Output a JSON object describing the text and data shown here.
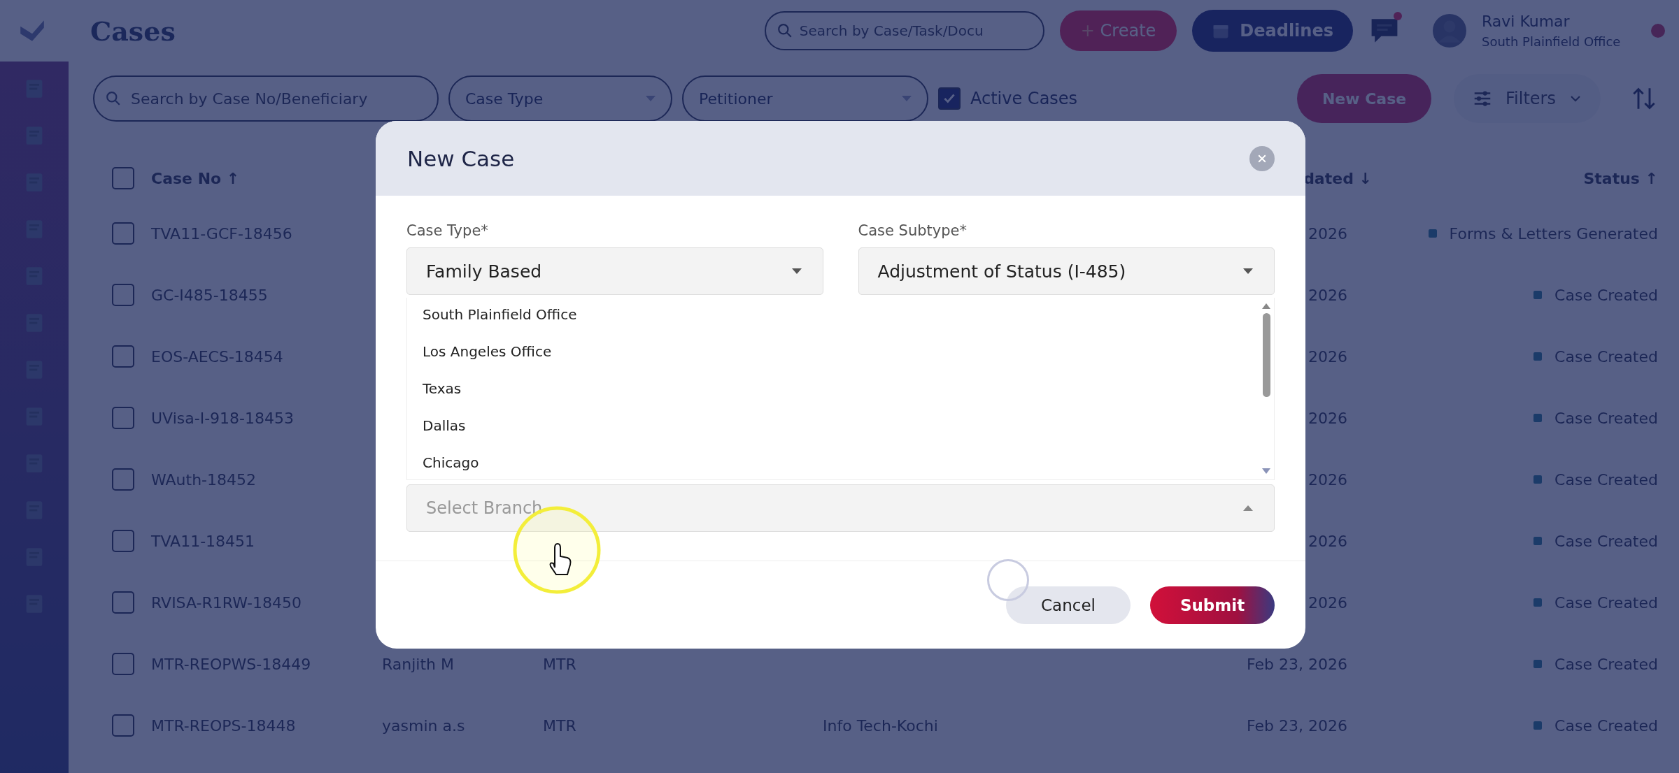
{
  "topbar": {
    "title": "Cases",
    "search": {
      "placeholder": "Search by Case/Task/Docu"
    },
    "create_button": {
      "icon": "+",
      "label": "Create"
    },
    "deadlines_button": "Deadlines",
    "chat": {
      "unread": true
    },
    "user": {
      "name": "Ravi Kumar",
      "office": "South Plainfield Office"
    }
  },
  "filters": {
    "search": {
      "placeholder": "Search by Case No/Beneficiary"
    },
    "selects": [
      {
        "placeholder": "Case Type"
      },
      {
        "placeholder": "Petitioner"
      }
    ],
    "active_cases": {
      "label": "Active Cases",
      "checked": true
    },
    "new_case_button": "New Case",
    "filters_button": "Filters"
  },
  "table": {
    "all_checked": false,
    "columns": [
      {
        "label": "Case No ↑"
      },
      {
        "label": "dated ↓"
      },
      {
        "label": "Status ↑"
      }
    ],
    "rows": [
      {
        "checked": false,
        "case_no": "TVA11-GCF-18456",
        "date": "2026",
        "status": "Forms & Letters Generated"
      },
      {
        "checked": false,
        "case_no": "GC-I485-18455",
        "date": "2026",
        "status": "Case Created"
      },
      {
        "checked": false,
        "case_no": "EOS-AECS-18454",
        "date": "2026",
        "status": "Case Created"
      },
      {
        "checked": false,
        "case_no": "UVisa-I-918-18453",
        "date": "2026",
        "status": "Case Created"
      },
      {
        "checked": false,
        "case_no": "WAuth-18452",
        "date": "2026",
        "status": "Case Created"
      },
      {
        "checked": false,
        "case_no": "TVA11-18451",
        "date": "2026",
        "status": "Case Created"
      },
      {
        "checked": false,
        "case_no": "RVISA-R1RW-18450",
        "date": "2026",
        "status": "Case Created"
      },
      {
        "checked": false,
        "case_no": "MTR-REOPWS-18449",
        "name": "Ranjith M",
        "type": "MTR",
        "date": "Feb 23, 2026",
        "status": "Case Created"
      },
      {
        "checked": false,
        "case_no": "MTR-REOPS-18448",
        "name": "yasmin a.s",
        "type": "MTR",
        "branch": "Info Tech-Kochi",
        "date": "Feb 23, 2026",
        "status": "Case Created"
      }
    ]
  },
  "modal": {
    "title": "New Case",
    "fields": [
      {
        "label": "Case Type*",
        "value": "Family Based"
      },
      {
        "label": "Case Subtype*",
        "value": "Adjustment of Status (I-485)"
      }
    ],
    "branch": {
      "placeholder": "Select Branch",
      "expanded": true,
      "options": [
        "South Plainfield Office",
        "Los Angeles Office",
        "Texas",
        "Dallas",
        "Chicago"
      ]
    },
    "buttons": {
      "cancel": "Cancel",
      "submit": "Submit"
    }
  }
}
